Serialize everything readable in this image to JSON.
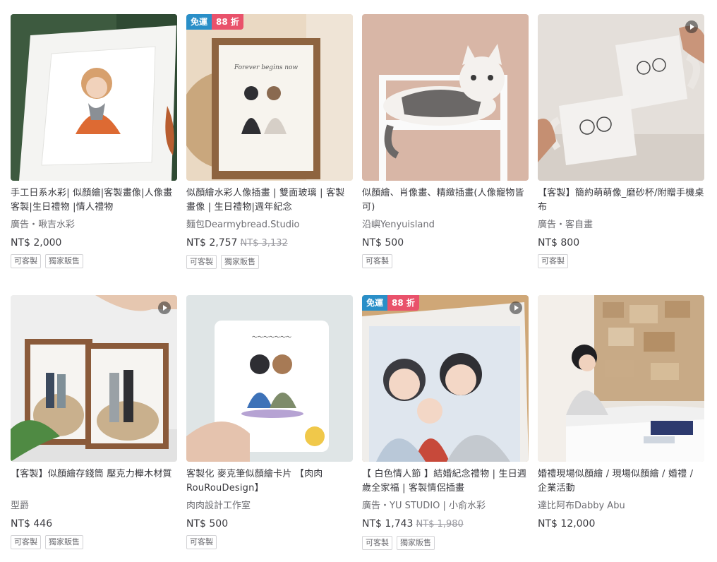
{
  "products": [
    {
      "title": "手工日系水彩| 似顏繪|客製畫像|人像畫客製|生日禮物 |情人禮物",
      "ad": "廣告・",
      "shop": "啾吉水彩",
      "price": "NT$ 2,000",
      "original_price": "",
      "badges": [],
      "video": false,
      "tags": [
        "可客製",
        "獨家販售"
      ],
      "thumb_icon": "watercolor-portrait-frame"
    },
    {
      "title": "似顏繪水彩人像插畫 | 雙面玻璃 | 客製畫像 | 生日禮物|週年紀念",
      "ad": "",
      "shop": "麵包Dearmybread.Studio",
      "price": "NT$ 2,757",
      "original_price": "NT$ 3,132",
      "badges": [
        "免運",
        "88 折"
      ],
      "video": false,
      "tags": [
        "可客製",
        "獨家販售"
      ],
      "thumb_icon": "couple-portrait-wood-frame"
    },
    {
      "title": "似顏繪、肖像畫、精緻插畫(人像寵物皆可)",
      "ad": "",
      "shop": "沿嶼Yenyuisland",
      "price": "NT$ 500",
      "original_price": "",
      "badges": [],
      "video": false,
      "tags": [
        "可客製"
      ],
      "thumb_icon": "cat-on-chair-illustration"
    },
    {
      "title": "【客製】簡約萌萌像_磨砂杯/附贈手機桌布",
      "ad": "廣告・",
      "shop": "客自畫",
      "price": "NT$ 800",
      "original_price": "",
      "badges": [],
      "video": true,
      "tags": [
        "可客製"
      ],
      "thumb_icon": "frosted-mugs-couple"
    },
    {
      "title": "【客製】似顏繪存錢筒 壓克力櫸木材質",
      "ad": "",
      "shop": "型爵",
      "price": "NT$ 446",
      "original_price": "",
      "badges": [],
      "video": true,
      "tags": [
        "可客製",
        "獨家販售"
      ],
      "thumb_icon": "acrylic-coin-bank"
    },
    {
      "title": "客製化 麥克筆似顏繪卡片 【肉肉RouRouDesign】",
      "ad": "",
      "shop": "肉肉設計工作室",
      "price": "NT$ 500",
      "original_price": "",
      "badges": [],
      "video": false,
      "tags": [
        "可客製"
      ],
      "thumb_icon": "marker-portrait-card"
    },
    {
      "title": "【 白色情人節 】結婚紀念禮物 | 生日週歲全家福 | 客製情侶插畫",
      "ad": "廣告・",
      "shop": "YU STUDIO | 小俞水彩",
      "price": "NT$ 1,743",
      "original_price": "NT$ 1,980",
      "badges": [
        "免運",
        "88 折"
      ],
      "video": true,
      "tags": [
        "可客製",
        "獨家販售"
      ],
      "thumb_icon": "family-portrait-illustration"
    },
    {
      "title": "婚禮現場似顏繪 / 現場似顏繪 / 婚禮 / 企業活動",
      "ad": "",
      "shop": "達比阿布Dabby Abu",
      "price": "NT$ 12,000",
      "original_price": "",
      "badges": [],
      "video": false,
      "tags": [],
      "thumb_icon": "live-drawing-event"
    }
  ]
}
